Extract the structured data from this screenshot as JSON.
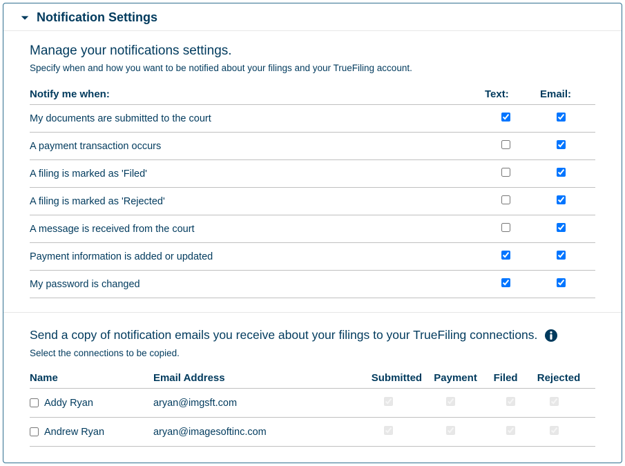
{
  "header": {
    "title": "Notification Settings"
  },
  "manage": {
    "title": "Manage your notifications settings.",
    "subtitle": "Specify when and how you want to be notified about your filings and your TrueFiling account.",
    "col_label": "Notify me when:",
    "col_text": "Text:",
    "col_email": "Email:",
    "rows": [
      {
        "label": "My documents are submitted to the court",
        "text": true,
        "email": true
      },
      {
        "label": "A payment transaction occurs",
        "text": false,
        "email": true
      },
      {
        "label": "A filing is marked as 'Filed'",
        "text": false,
        "email": true
      },
      {
        "label": "A filing is marked as 'Rejected'",
        "text": false,
        "email": true
      },
      {
        "label": "A message is received from the court",
        "text": false,
        "email": true
      },
      {
        "label": "Payment information is added or updated",
        "text": true,
        "email": true
      },
      {
        "label": "My password is changed",
        "text": true,
        "email": true
      }
    ]
  },
  "copy": {
    "title": "Send a copy of notification emails you receive about your filings to your TrueFiling connections.",
    "subtitle": "Select the connections to be copied.",
    "col_name": "Name",
    "col_email": "Email Address",
    "col_submitted": "Submitted",
    "col_payment": "Payment",
    "col_filed": "Filed",
    "col_rejected": "Rejected",
    "rows": [
      {
        "selected": false,
        "name": "Addy Ryan",
        "email": "aryan@imgsft.com",
        "submitted": true,
        "payment": true,
        "filed": true,
        "rejected": true
      },
      {
        "selected": false,
        "name": "Andrew Ryan",
        "email": "aryan@imagesoftinc.com",
        "submitted": true,
        "payment": true,
        "filed": true,
        "rejected": true
      }
    ]
  }
}
